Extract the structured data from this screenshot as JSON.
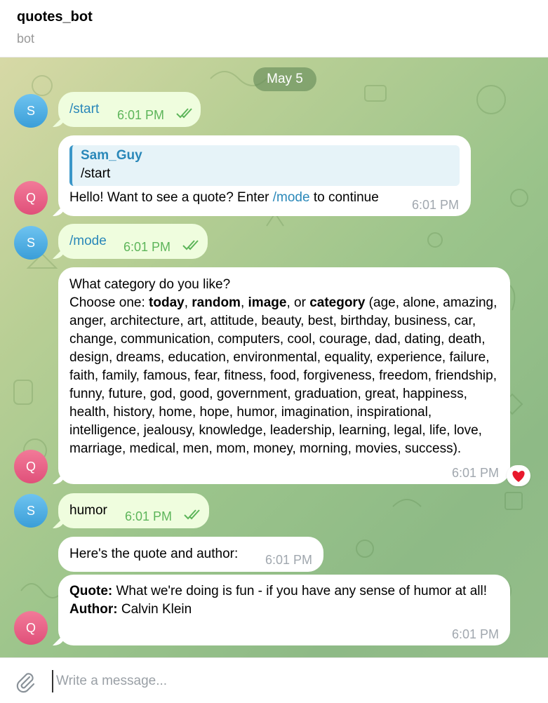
{
  "header": {
    "title": "quotes_bot",
    "subtitle": "bot"
  },
  "date_separator": "May 5",
  "avatars": {
    "user": "S",
    "bot": "Q"
  },
  "messages": {
    "m1": {
      "text": "/start",
      "time": "6:01 PM"
    },
    "m2": {
      "reply_name": "Sam_Guy",
      "reply_text": "/start",
      "text_before": "Hello! Want to see a quote? Enter ",
      "command": "/mode",
      "text_after": " to continue",
      "time": "6:01 PM"
    },
    "m3": {
      "text": "/mode",
      "time": "6:01 PM"
    },
    "m4": {
      "line1": "What category do you like?",
      "choose": "Choose one: ",
      "opt1": "today",
      "sep1": ", ",
      "opt2": "random",
      "sep2": ", ",
      "opt3": "image",
      "sep3": ", or ",
      "opt4": "category",
      "categories": " (age, alone, amazing, anger, architecture, art, attitude, beauty, best, birthday, business, car, change, communication, computers, cool, courage, dad, dating, death, design, dreams, education, environmental, equality, experience, failure, faith, family, famous, fear, fitness, food, forgiveness, freedom, friendship, funny, future, god, good, government, graduation, great, happiness, health, history, home, hope, humor, imagination, inspirational, intelligence, jealousy, knowledge, leadership, learning, legal, life, love, marriage, medical, men, mom, money, morning, movies, success).",
      "time": "6:01 PM",
      "reaction": "heart-icon"
    },
    "m5": {
      "text": "humor",
      "time": "6:01 PM"
    },
    "m6": {
      "text": "Here's the quote and author:",
      "time": "6:01 PM"
    },
    "m7": {
      "quote_label": "Quote:",
      "quote_text": " What we're doing is fun - if you have any sense of humor at all!",
      "author_label": "Author:",
      "author_text": " Calvin Klein",
      "time": "6:01 PM"
    }
  },
  "composer": {
    "placeholder": "Write a message...",
    "attach_icon": "paperclip-icon"
  },
  "colors": {
    "out_bubble": "#effdde",
    "in_bubble": "#ffffff",
    "link": "#2a88b9",
    "out_time": "#5db55a",
    "in_time": "#a0a7ae",
    "reaction_heart": "#e8182c"
  }
}
